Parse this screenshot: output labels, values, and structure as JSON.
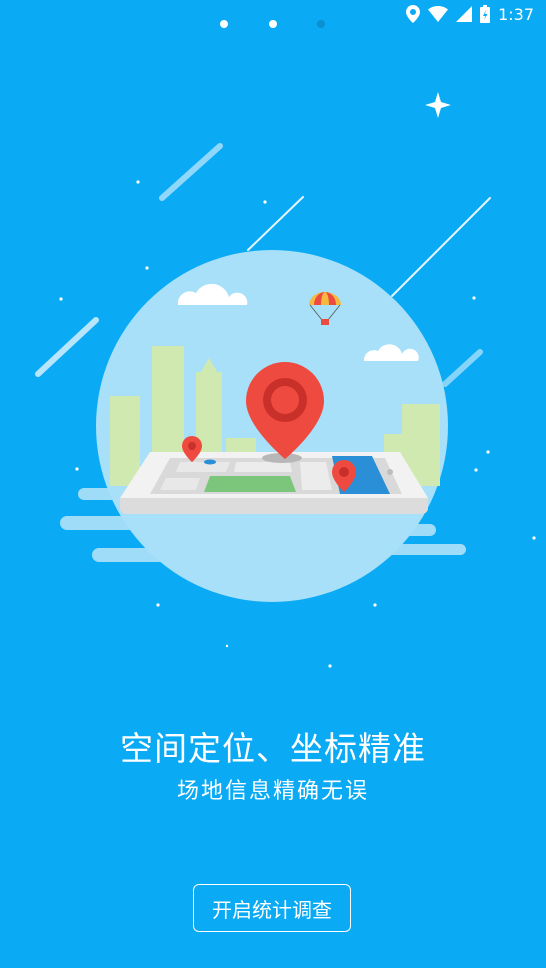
{
  "status_bar": {
    "time": "1:37",
    "icons": [
      "location-icon",
      "wifi-icon",
      "signal-icon",
      "battery-icon"
    ]
  },
  "pager": {
    "total": 3,
    "active_index": 2
  },
  "illustration": {
    "icon": "map-location-pin-illustration"
  },
  "main": {
    "title": "空间定位、坐标精准",
    "subtitle": "场地信息精确无误",
    "start_button_label": "开启统计调查"
  },
  "colors": {
    "background": "#0aaaf5",
    "circle": "#a7e0f8",
    "pin": "#ef4a3f",
    "text": "#ffffff"
  }
}
